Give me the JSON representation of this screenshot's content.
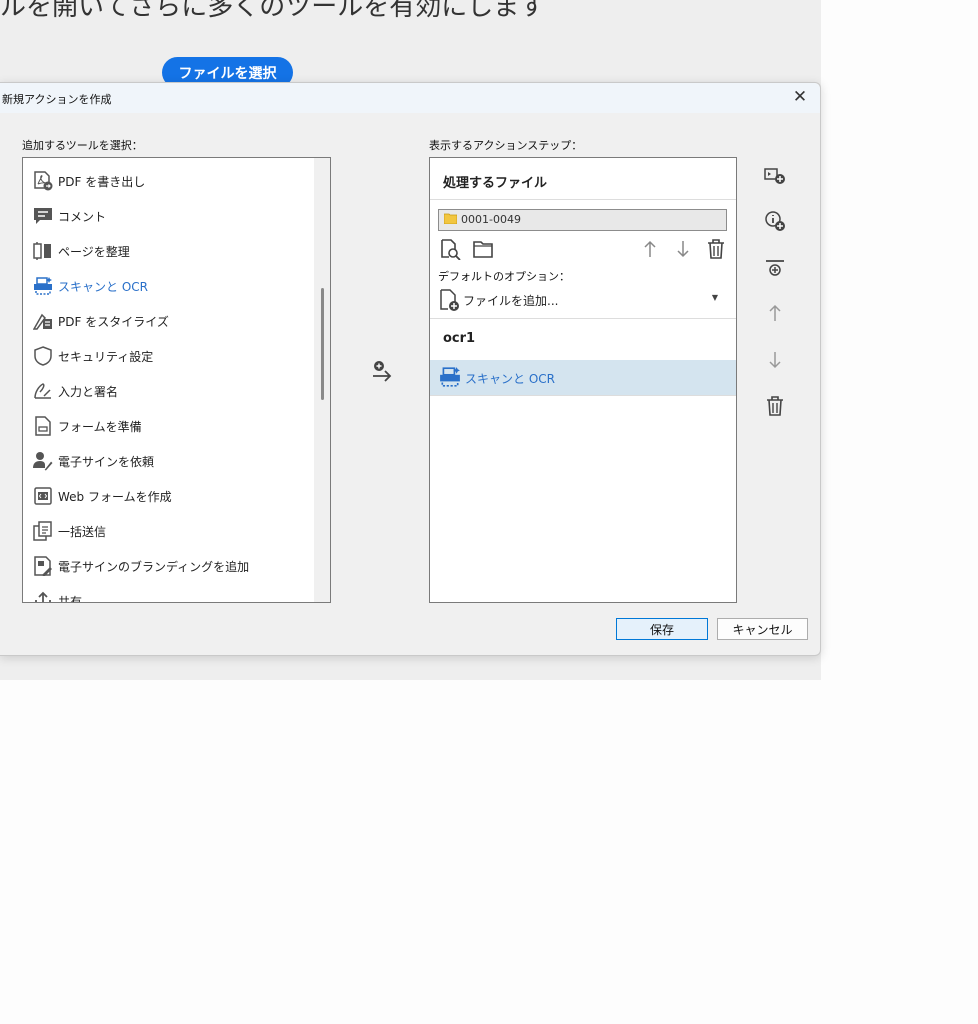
{
  "background": {
    "heading": "ルを開いてさらに多くのツールを有効にします",
    "select_file_button": "ファイルを選択"
  },
  "dialog": {
    "title": "新規アクションを作成",
    "close_icon": "close-icon",
    "left_label": "追加するツールを選択：",
    "right_label": "表示するアクションステップ：",
    "tools": [
      {
        "label": "PDF を書き出し",
        "icon": "export-pdf-icon"
      },
      {
        "label": "コメント",
        "icon": "comment-icon"
      },
      {
        "label": "ページを整理",
        "icon": "organize-pages-icon"
      },
      {
        "label": "スキャンと OCR",
        "icon": "scan-ocr-icon"
      },
      {
        "label": "PDF をスタイライズ",
        "icon": "stylize-pdf-icon"
      },
      {
        "label": "セキュリティ設定",
        "icon": "shield-icon"
      },
      {
        "label": "入力と署名",
        "icon": "fill-sign-icon"
      },
      {
        "label": "フォームを準備",
        "icon": "prepare-form-icon"
      },
      {
        "label": "電子サインを依頼",
        "icon": "request-esign-icon"
      },
      {
        "label": "Web フォームを作成",
        "icon": "web-form-icon"
      },
      {
        "label": "一括送信",
        "icon": "send-in-bulk-icon"
      },
      {
        "label": "電子サインのブランディングを追加",
        "icon": "esign-branding-icon"
      },
      {
        "label": "共有",
        "icon": "share-icon"
      }
    ],
    "steps": {
      "files_header": "処理するファイル",
      "file_value": "0001-0049",
      "default_options_label": "デフォルトのオプション：",
      "add_file_option": "ファイルを追加...",
      "step_name": "ocr1",
      "step_item": "スキャンと OCR"
    },
    "save_button": "保存",
    "cancel_button": "キャンセル"
  },
  "colors": {
    "accent": "#1473e6",
    "link_blue": "#2a70c9",
    "selected_row": "#d4e4ef"
  }
}
